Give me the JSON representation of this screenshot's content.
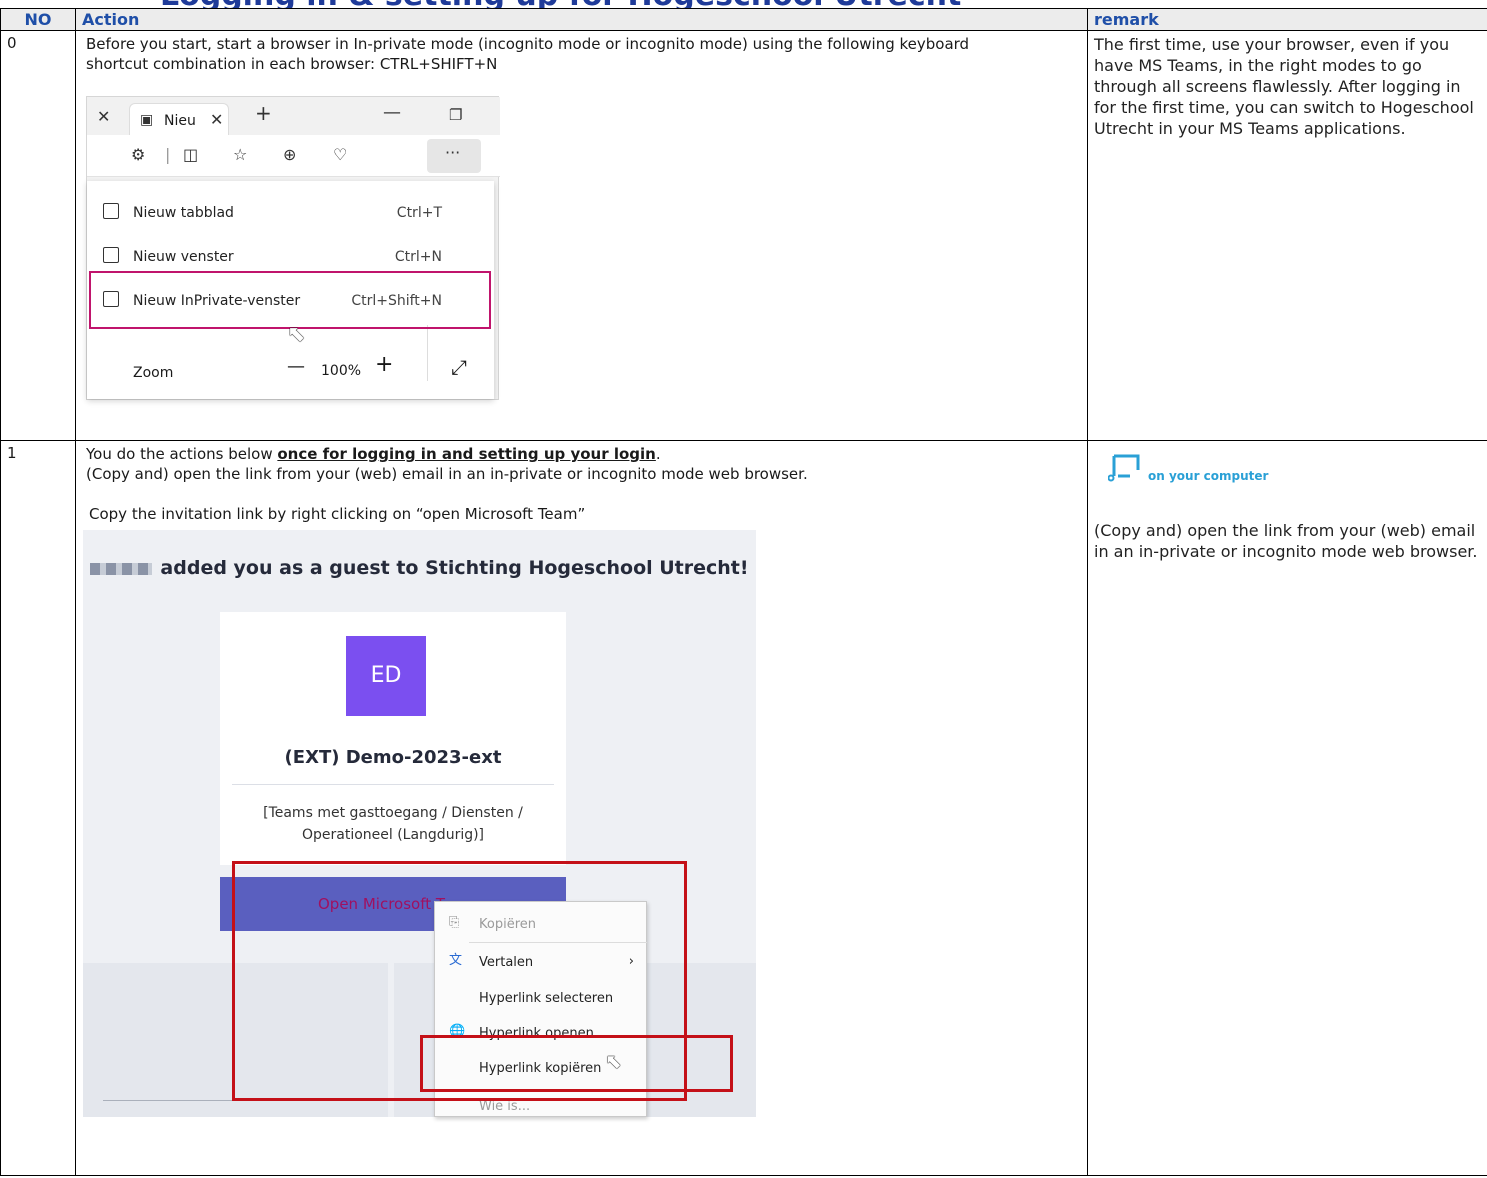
{
  "document": {
    "title_fragment": "Logging in & setting up for Hogeschool Utrecht"
  },
  "table": {
    "headers": {
      "no": "NO",
      "action": "Action",
      "remark": "remark"
    },
    "rows": [
      {
        "no": "0",
        "action": {
          "text": "Before you start, start a browser in In-private mode (incognito mode or incognito mode) using the following keyboard shortcut combination in each browser: CTRL+SHIFT+N"
        },
        "remark": "The first time, use your browser, even if you have MS Teams, in the right modes to go through all screens flawlessly. After logging in for the first time, you can switch to Hogeschool Utrecht in your MS Teams applications."
      },
      {
        "no": "1",
        "action": {
          "intro_before": "You do the actions below ",
          "intro_bold": "once for logging in and setting up your login",
          "intro_after": ".",
          "line2": "(Copy and) open the link from your (web) email in an in-private or incognito mode web browser.",
          "copy_instruction": "Copy the invitation link by right clicking on “open Microsoft Team”"
        },
        "remark_heading": "on your computer",
        "remark": "(Copy and) open the link from your (web) email in an in-private or incognito mode web browser."
      }
    ]
  },
  "edge_menu": {
    "tab_label": "Nieu",
    "items": [
      {
        "label": "Nieuw tabblad",
        "shortcut": "Ctrl+T"
      },
      {
        "label": "Nieuw venster",
        "shortcut": "Ctrl+N"
      },
      {
        "label": "Nieuw InPrivate-venster",
        "shortcut": "Ctrl+Shift+N"
      }
    ],
    "zoom": {
      "label": "Zoom",
      "value": "100%"
    }
  },
  "invite": {
    "headline": "added you as a guest to Stichting Hogeschool Utrecht!",
    "avatar_initials": "ED",
    "team_name": "(EXT) Demo-2023-ext",
    "team_description": "[Teams met gasttoegang / Diensten / Operationeel (Langdurig)]",
    "button_label": "Open Microsoft T",
    "context_menu": [
      {
        "label": "Kopiëren",
        "enabled": false
      },
      {
        "label": "Vertalen",
        "enabled": true
      },
      {
        "label": "Hyperlink selecteren",
        "enabled": true
      },
      {
        "label": "Hyperlink openen",
        "enabled": true
      },
      {
        "label": "Hyperlink kopiëren",
        "enabled": true
      },
      {
        "label": "Wie is...",
        "enabled": false
      }
    ]
  },
  "colors": {
    "header_text": "#1f4fa8",
    "highlight_magenta": "#c0146c",
    "highlight_red": "#c41018",
    "avatar": "#7b4ff0",
    "teams_button": "#5a5fbf",
    "accent_cyan": "#2aa0d6"
  },
  "icons": [
    "close-icon",
    "tab-icon",
    "plus-icon",
    "minimize-icon",
    "restore-icon",
    "extensions-icon",
    "split-screen-icon",
    "favorites-icon",
    "collections-icon",
    "health-icon",
    "more-icon",
    "expand-icon",
    "cursor-icon",
    "translate-icon",
    "link-open-icon",
    "copy-icon",
    "computer-icon"
  ]
}
